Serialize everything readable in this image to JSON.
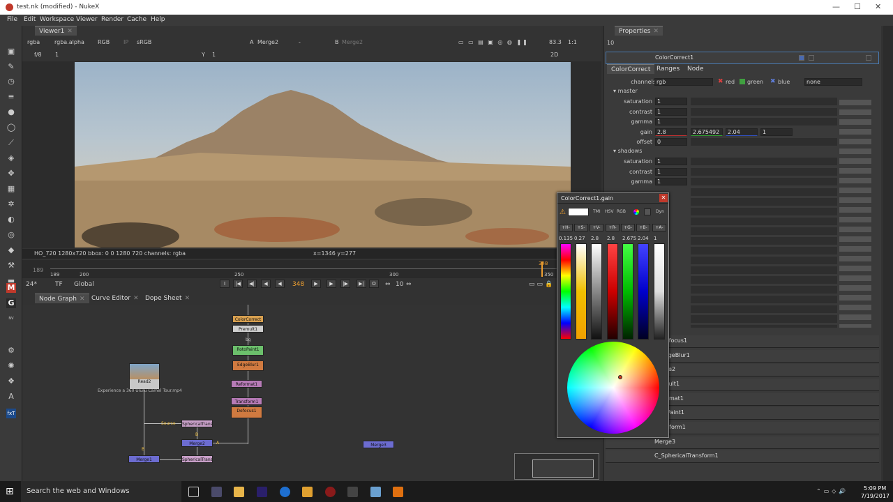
{
  "window": {
    "title": "test.nk (modified) - NukeX",
    "min": "—",
    "max": "☐",
    "close": "✕"
  },
  "menu": [
    "File",
    "Edit",
    "Workspace",
    "Viewer",
    "Render",
    "Cache",
    "Help"
  ],
  "viewer": {
    "tab": "Viewer1",
    "channels": "rgba",
    "alpha": "rgba.alpha",
    "colorspace": "RGB",
    "ip": "IP",
    "lut": "sRGB",
    "inputA_label": "A",
    "inputA": "Merge2",
    "inputA2": "-",
    "inputB_label": "B",
    "inputB": "Merge2",
    "zoom": "83.3",
    "ratio": "1:1",
    "mode": "2D",
    "fstop": "f/8",
    "frameinfo": "1",
    "y_label": "Y",
    "y_val": "1",
    "status_left": "HO_720 1280x720  bbox: 0 0 1280 720 channels: rgba",
    "status_mid": "x=1346 y=277"
  },
  "timeline": {
    "start": "189",
    "ticks": [
      "189",
      "200",
      "250",
      "300",
      "350"
    ],
    "current": "348",
    "fps": "24*",
    "tf": "TF",
    "range": "Global",
    "frame_field": "348",
    "step": "10",
    "playhead_frac": 0.92
  },
  "nodegraph": {
    "tabs": [
      "Node Graph",
      "Curve Editor",
      "Dope Sheet"
    ],
    "nodes": [
      {
        "label": "ColorCorrect",
        "color": "#d8a050"
      },
      {
        "label": "Premult1",
        "color": "#cfcfcf"
      },
      {
        "label": "bg",
        "color": ""
      },
      {
        "label": "RotoPaint1",
        "color": "#6cc06c"
      },
      {
        "label": "EdgeBlur1",
        "color": "#d07a40"
      },
      {
        "label": "Reformat1",
        "color": "#b77bb7"
      },
      {
        "label": "Transform1",
        "color": "#b77bb7"
      },
      {
        "label": "Defocus1",
        "color": "#d07a40"
      },
      {
        "label": "Read2",
        "color": "#c8c8c8"
      },
      {
        "label": "Experience a 360 Uluru Camel Tour.mp4",
        "color": ""
      },
      {
        "label": "SphericalTransform1",
        "color": "#c8a0c8"
      },
      {
        "label": "Merge2",
        "color": "#6c6cd0"
      },
      {
        "label": "SphericalTransform2",
        "color": "#c8a0c8"
      },
      {
        "label": "Merge1",
        "color": "#6c6cd0"
      },
      {
        "label": "Merge3",
        "color": "#6c6cd0"
      }
    ],
    "pin_source": "Source",
    "pin_a": "A",
    "pin_b": "B",
    "pin_b2": "B"
  },
  "properties": {
    "title": "Properties",
    "count": "10",
    "panel": "ColorCorrect1",
    "subtabs": [
      "ColorCorrect",
      "Ranges",
      "Node"
    ],
    "channels_label": "channels",
    "channels": "rgb",
    "ch_red": "red",
    "ch_green": "green",
    "ch_blue": "blue",
    "ch_none": "none",
    "master": "master",
    "shadows": "shadows",
    "m_sat": {
      "label": "saturation",
      "value": "1"
    },
    "m_con": {
      "label": "contrast",
      "value": "1"
    },
    "m_gam": {
      "label": "gamma",
      "value": "1"
    },
    "m_gain": {
      "label": "gain",
      "v1": "2.8",
      "v2": "2.675492",
      "v3": "2.04",
      "v4": "1"
    },
    "m_off": {
      "label": "offset",
      "value": "0"
    },
    "s_sat": {
      "label": "saturation",
      "value": "1"
    },
    "s_con": {
      "label": "contrast",
      "value": "1"
    },
    "s_gam": {
      "label": "gamma",
      "value": "1"
    },
    "collapsed": [
      "C_Defocus1",
      "C_EdgeBlur1",
      "Merge2",
      "Premult1",
      "Reformat1",
      "RotoPaint1",
      "Transform1",
      "Merge3",
      "C_SphericalTransform1"
    ]
  },
  "picker": {
    "title": "ColorCorrect1.gain",
    "modes": [
      "TMI",
      "HSV",
      "RGB"
    ],
    "dyn": "Dyn",
    "btns": [
      "+H-",
      "+S-",
      "+V-",
      "+R-",
      "+G-",
      "+B-",
      "+A-"
    ],
    "vals": [
      "0.135",
      "0.27",
      "2.8",
      "2.8",
      "2.675",
      "2.04",
      "1"
    ]
  },
  "taskbar": {
    "search": "Search the web and Windows",
    "time": "5:09 PM",
    "date": "7/19/2017"
  }
}
